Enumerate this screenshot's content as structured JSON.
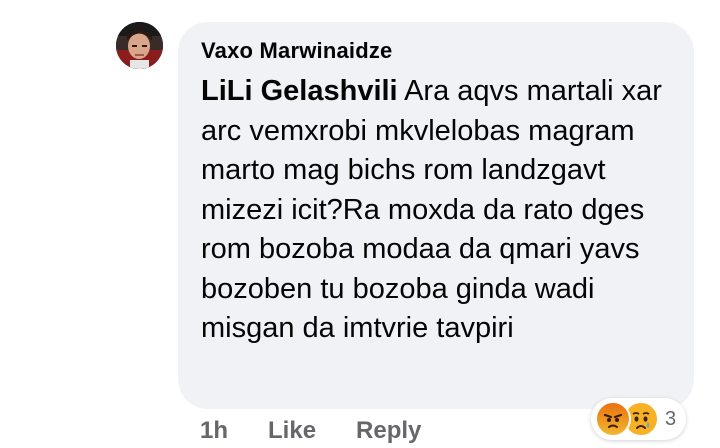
{
  "comment": {
    "author": "Vaxo Marwinaidze",
    "mention": "LiLi Gelashvili",
    "text": " Ara aqvs martali xar arc vemxrobi mkvlelobas magram marto mag bichs rom landzgavt mizezi icit?Ra moxda da rato dges rom bozoba modaa da qmari yavs bozoben tu bozoba ginda wadi misgan da imtvrie tavpiri"
  },
  "actions": {
    "time": "1h",
    "like": "Like",
    "reply": "Reply"
  },
  "reactions": {
    "icons": [
      "angry-icon",
      "sad-icon"
    ],
    "count": "3",
    "colors": {
      "angry": "#e9710f",
      "sad": "#f7b125"
    }
  }
}
